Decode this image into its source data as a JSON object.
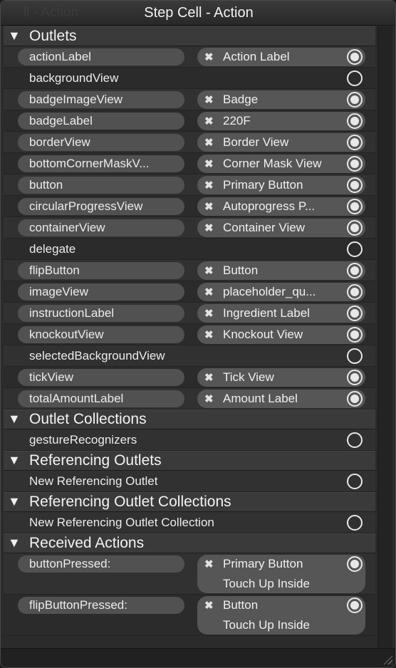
{
  "window": {
    "title": "Step Cell - Action",
    "ghost_title": "ll - Action"
  },
  "sections": [
    {
      "title": "Outlets",
      "rows": [
        {
          "name": "actionLabel",
          "target": "Action Label",
          "connected": true
        },
        {
          "name": "backgroundView",
          "target": "",
          "connected": false
        },
        {
          "name": "badgeImageView",
          "target": "Badge",
          "connected": true
        },
        {
          "name": "badgeLabel",
          "target": "220F",
          "connected": true
        },
        {
          "name": "borderView",
          "target": "Border View",
          "connected": true
        },
        {
          "name": "bottomCornerMaskV...",
          "target": "Corner Mask View",
          "connected": true
        },
        {
          "name": "button",
          "target": "Primary Button",
          "connected": true
        },
        {
          "name": "circularProgressView",
          "target": "Autoprogress P...",
          "connected": true
        },
        {
          "name": "containerView",
          "target": "Container View",
          "connected": true
        },
        {
          "name": "delegate",
          "target": "",
          "connected": false
        },
        {
          "name": "flipButton",
          "target": "Button",
          "connected": true
        },
        {
          "name": "imageView",
          "target": "placeholder_qu...",
          "connected": true
        },
        {
          "name": "instructionLabel",
          "target": "Ingredient Label",
          "connected": true
        },
        {
          "name": "knockoutView",
          "target": "Knockout View",
          "connected": true
        },
        {
          "name": "selectedBackgroundView",
          "target": "",
          "connected": false
        },
        {
          "name": "tickView",
          "target": "Tick View",
          "connected": true
        },
        {
          "name": "totalAmountLabel",
          "target": "Amount Label",
          "connected": true
        }
      ]
    },
    {
      "title": "Outlet Collections",
      "rows": [
        {
          "name": "gestureRecognizers",
          "target": "",
          "connected": false
        }
      ]
    },
    {
      "title": "Referencing Outlets",
      "rows": [
        {
          "name": "New Referencing Outlet",
          "target": "",
          "connected": false
        }
      ]
    },
    {
      "title": "Referencing Outlet Collections",
      "rows": [
        {
          "name": "New Referencing Outlet Collection",
          "target": "",
          "connected": false
        }
      ]
    },
    {
      "title": "Received Actions",
      "rows": [
        {
          "name": "buttonPressed:",
          "target": "Primary Button",
          "sub": "Touch Up Inside",
          "connected": true
        },
        {
          "name": "flipButtonPressed:",
          "target": "Button",
          "sub": "Touch Up Inside",
          "connected": true
        }
      ]
    }
  ],
  "icons": {
    "disclosure": "▼",
    "disconnect": "✖"
  },
  "colors": {
    "panel": "#2b2b2b",
    "section_header": "#3a3a3a",
    "pill": "#515151",
    "text": "#ececec"
  }
}
